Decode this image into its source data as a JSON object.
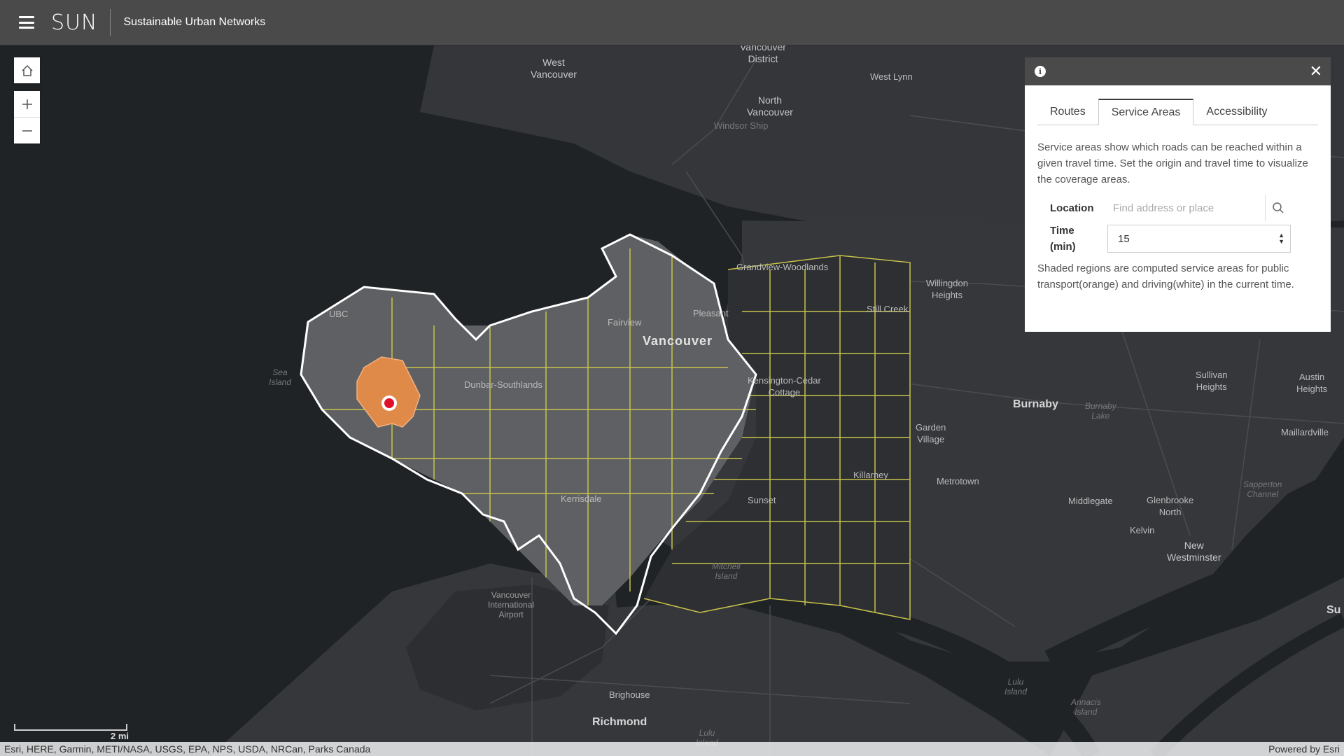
{
  "header": {
    "app_short": "SUN",
    "app_name": "Sustainable Urban Networks"
  },
  "map_labels": {
    "west_vancouver": "West\nVancouver",
    "vancouver_district": "Vancouver\nDistrict",
    "west_lynn": "West Lynn",
    "north_vancouver": "North\nVancouver",
    "windsor_ship": "Windsor Ship",
    "grandview": "Grandview-Woodlands",
    "willingdon": "Willingdon\nHeights",
    "still_creek": "Still Creek",
    "ubc": "UBC",
    "fairview": "Fairview",
    "pleasant": "Pleasant",
    "vancouver": "Vancouver",
    "sea_island": "Sea\nIsland",
    "dunbar": "Dunbar-Southlands",
    "kensington": "Kensington-Cedar\nCottage",
    "burnaby": "Burnaby",
    "burnaby_lake": "Burnaby\nLake",
    "sullivan": "Sullivan\nHeights",
    "austin": "Austin\nHeights",
    "maillardville": "Maillardville",
    "garden_village": "Garden\nVillage",
    "killarney": "Killarney",
    "metrotown": "Metrotown",
    "kerrisdale": "Kerrisdale",
    "sunset": "Sunset",
    "middlegate": "Middlegate",
    "glenbrooke": "Glenbrooke\nNorth",
    "sapperton": "Sapperton\nChannel",
    "kelvin": "Kelvin",
    "new_westminster": "New\nWestminster",
    "mitchell": "Mitchell\nIsland",
    "airport": "Vancouver\nInternational\nAirport",
    "brighouse": "Brighouse",
    "richmond": "Richmond",
    "lulu1": "Lulu\nIsland",
    "annacis": "Annacis\nIsland",
    "lulu2": "Lulu\nIsland",
    "su": "Su"
  },
  "panel": {
    "tabs": [
      "Routes",
      "Service Areas",
      "Accessibility"
    ],
    "active_tab": "Service Areas",
    "description": "Service areas show which roads can be reached within a given travel time. Set the origin and travel time to visualize the coverage areas.",
    "location_label": "Location",
    "location_placeholder": "Find address or place",
    "time_label": "Time\n(min)",
    "time_value": "15",
    "note": "Shaded regions are computed service areas for public transport(orange) and driving(white) in the current time."
  },
  "scale": {
    "label": "2 mi"
  },
  "attribution": {
    "sources": "Esri, HERE, Garmin, METI/NASA, USGS, EPA, NPS, USDA, NRCan, Parks Canada",
    "powered_by": "Powered by Esri"
  },
  "colors": {
    "driving_area": "#ffffff",
    "transit_area": "#e08a4a",
    "boundary": "#c8c24a",
    "origin": "#e0102a"
  }
}
